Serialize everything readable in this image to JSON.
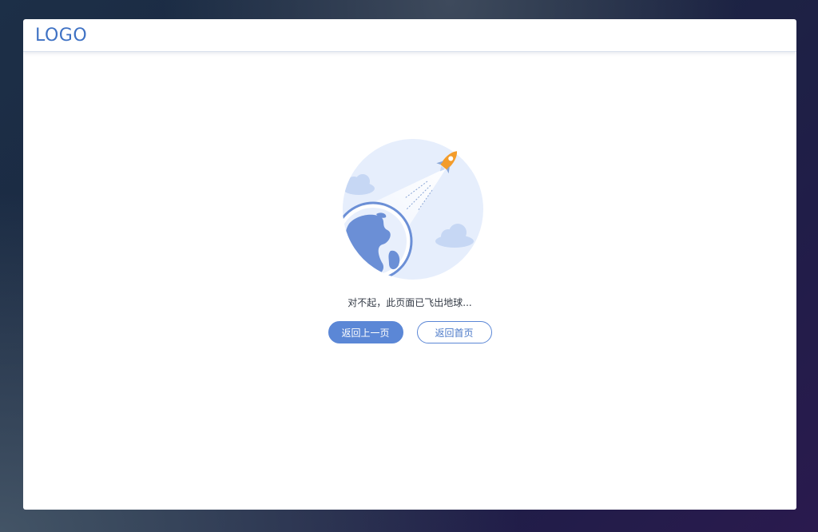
{
  "header": {
    "logo": "LOGO"
  },
  "main": {
    "illustration_icon": "rocket-leaving-earth-icon",
    "message": "对不起，此页面已飞出地球...",
    "buttons": {
      "back_label": "返回上一页",
      "home_label": "返回首页"
    }
  },
  "colors": {
    "accent": "#5b87d6",
    "logo": "#3f72c4",
    "illustration_bg": "#e6eefc",
    "rocket": "#f39c2b"
  }
}
